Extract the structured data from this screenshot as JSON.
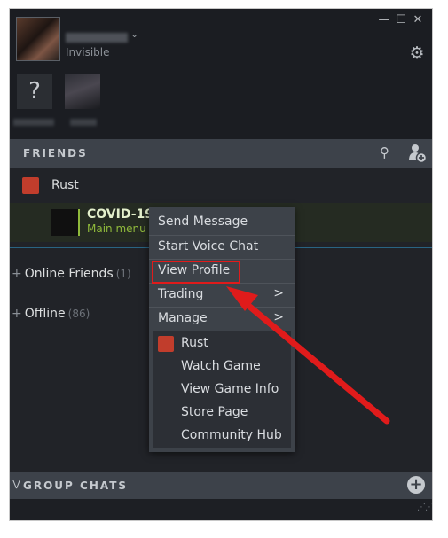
{
  "header": {
    "status": "Invisible",
    "window_controls": [
      "minimize-icon",
      "maximize-icon",
      "close-icon"
    ],
    "settings_icon": "gear-icon",
    "recent_tile_unknown": "?"
  },
  "friends_bar": {
    "title": "FRIENDS",
    "search_icon": "search-icon",
    "add_friend_icon": "add-friend-icon"
  },
  "list": {
    "game_group": {
      "name": "Rust"
    },
    "friend": {
      "name": "COVID-19",
      "status": "Main menu"
    },
    "groups": [
      {
        "label": "Online Friends",
        "count": "(1)"
      },
      {
        "label": "Offline",
        "count": "(86)"
      }
    ]
  },
  "context_menu": {
    "items": [
      {
        "label": "Send Message"
      },
      {
        "label": "Start Voice Chat"
      },
      {
        "label": "View Profile",
        "highlighted": true
      },
      {
        "label": "Trading",
        "submenu_arrow": ">"
      },
      {
        "label": "Manage",
        "submenu_arrow": ">"
      }
    ],
    "game_section": {
      "title": "Rust",
      "items": [
        {
          "label": "Watch Game"
        },
        {
          "label": "View Game Info"
        },
        {
          "label": "Store Page"
        },
        {
          "label": "Community Hub"
        }
      ]
    }
  },
  "group_chats_bar": {
    "title": "GROUP CHATS",
    "add_icon": "+"
  },
  "colors": {
    "annotation_red": "#e01b1b",
    "ingame_green": "#8fb93b",
    "panel_bg": "#212328",
    "menu_bg": "#3d4249"
  }
}
